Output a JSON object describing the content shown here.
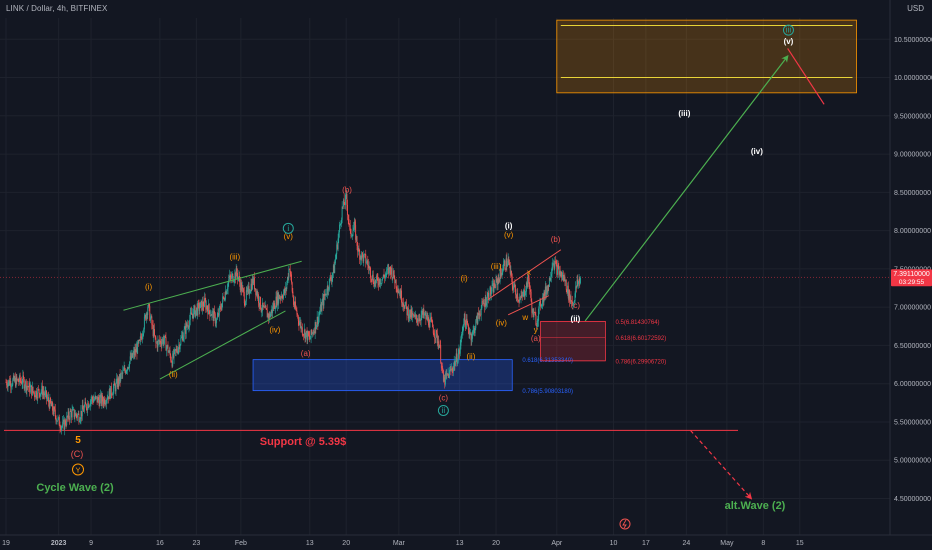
{
  "header": {
    "title": "LINK / Dollar, 4h, BITFINEX",
    "currency": "USD"
  },
  "price_tag": {
    "price": "7.39110000",
    "countdown": "03:29:55",
    "color": "#f23645"
  },
  "colors": {
    "background": "#131722",
    "up": "#26a69a",
    "down": "#ef5350",
    "support": "#f23645",
    "fib_zone_blue": "#2962ff",
    "fib_zone_red": "#f23645",
    "target_box": "#ff9800",
    "path_green": "#4caf50",
    "path_red": "#f23645"
  },
  "annotations": {
    "support": "Support @ 5.39$",
    "cycle_wave": "Cycle Wave (2)",
    "alt_wave": "alt.Wave (2)",
    "wave_5": "5",
    "wave_C": "(C)",
    "wave_Y": "Y"
  },
  "wave_labels": [
    {
      "text": "(i)",
      "color": "#ff9800",
      "t": 35.2,
      "p": 7.23
    },
    {
      "text": "(ii)",
      "color": "#ff9800",
      "t": 41.3,
      "p": 6.09
    },
    {
      "text": "(iii)",
      "color": "#ff9800",
      "t": 56.5,
      "p": 7.62
    },
    {
      "text": "(iv)",
      "color": "#ff9800",
      "t": 66.4,
      "p": 6.67
    },
    {
      "text": "(v)",
      "color": "#ff9800",
      "t": 69.7,
      "p": 7.89
    },
    {
      "text": "(a)",
      "color": "#ef5350",
      "t": 74.0,
      "p": 6.36
    },
    {
      "text": "(b)",
      "color": "#ef5350",
      "t": 84.2,
      "p": 8.5
    },
    {
      "text": "(c)",
      "color": "#ef5350",
      "t": 108.0,
      "p": 5.78
    },
    {
      "text": "(i)",
      "color": "#ff9800",
      "t": 113.1,
      "p": 7.34
    },
    {
      "text": "(ii)",
      "color": "#ff9800",
      "t": 114.8,
      "p": 6.32
    },
    {
      "text": "(iii)",
      "color": "#ff9800",
      "t": 121.0,
      "p": 7.5
    },
    {
      "text": "(iv)",
      "color": "#ff9800",
      "t": 122.3,
      "p": 6.76
    },
    {
      "text": "(v)",
      "color": "#ff9800",
      "t": 124.1,
      "p": 7.91
    },
    {
      "text": "(i)",
      "color": "#ffffff",
      "t": 124.1,
      "p": 8.03
    },
    {
      "text": "(b)",
      "color": "#ef5350",
      "t": 135.7,
      "p": 7.85
    },
    {
      "text": "x",
      "color": "#ff9800",
      "t": 129.1,
      "p": 7.42
    },
    {
      "text": "w",
      "color": "#ff9800",
      "t": 128.2,
      "p": 6.83
    },
    {
      "text": "y",
      "color": "#ff9800",
      "t": 130.8,
      "p": 6.67
    },
    {
      "text": "(a)",
      "color": "#ef5350",
      "t": 130.8,
      "p": 6.56
    },
    {
      "text": "(c)",
      "color": "#ef5350",
      "t": 140.6,
      "p": 6.99
    },
    {
      "text": "(ii)",
      "color": "#ffffff",
      "t": 140.6,
      "p": 6.81
    },
    {
      "text": "(iii)",
      "color": "#ffffff",
      "t": 167.5,
      "p": 9.5
    },
    {
      "text": "(iv)",
      "color": "#ffffff",
      "t": 185.4,
      "p": 9.0
    },
    {
      "text": "(v)",
      "color": "#ffffff",
      "t": 193.2,
      "p": 10.44
    }
  ],
  "circle_labels": [
    {
      "text": "i",
      "color": "#26a69a",
      "t": 69.7,
      "p": 8.03
    },
    {
      "text": "ii",
      "color": "#26a69a",
      "t": 108.0,
      "p": 5.65
    },
    {
      "text": "iii",
      "color": "#26a69a",
      "t": 193.2,
      "p": 10.62
    }
  ],
  "chart_data": {
    "type": "candlestick",
    "symbol": "LINK / Dollar",
    "interval": "4h",
    "exchange": "BITFINEX",
    "y_axis": {
      "ticks": [
        {
          "v": 10.5,
          "label": "10.50000000"
        },
        {
          "v": 10.0,
          "label": "10.00000000"
        },
        {
          "v": 9.5,
          "label": "9.50000000"
        },
        {
          "v": 9.0,
          "label": "9.00000000"
        },
        {
          "v": 8.5,
          "label": "8.50000000"
        },
        {
          "v": 8.0,
          "label": "8.00000000"
        },
        {
          "v": 7.5,
          "label": "7.50000000"
        },
        {
          "v": 7.0,
          "label": "7.00000000"
        },
        {
          "v": 6.5,
          "label": "6.50000000"
        },
        {
          "v": 6.0,
          "label": "6.00000000"
        },
        {
          "v": 5.5,
          "label": "5.50000000"
        },
        {
          "v": 5.0,
          "label": "5.00000000"
        },
        {
          "v": 4.5,
          "label": "4.50000000"
        }
      ],
      "range": [
        4.0,
        11.2
      ]
    },
    "x_axis": {
      "range_days": [
        -1,
        211
      ],
      "ticks": [
        {
          "t": 0,
          "label": "19"
        },
        {
          "t": 13,
          "label": "2023",
          "bold": true
        },
        {
          "t": 21,
          "label": "9"
        },
        {
          "t": 38,
          "label": "16"
        },
        {
          "t": 47,
          "label": "23"
        },
        {
          "t": 58,
          "label": "Feb"
        },
        {
          "t": 75,
          "label": "13"
        },
        {
          "t": 84,
          "label": "20"
        },
        {
          "t": 97,
          "label": "Mar"
        },
        {
          "t": 112,
          "label": "13"
        },
        {
          "t": 121,
          "label": "20"
        },
        {
          "t": 136,
          "label": "Apr"
        },
        {
          "t": 150,
          "label": "10"
        },
        {
          "t": 158,
          "label": "17"
        },
        {
          "t": 168,
          "label": "24"
        },
        {
          "t": 178,
          "label": "May"
        },
        {
          "t": 187,
          "label": "8"
        },
        {
          "t": 196,
          "label": "15"
        }
      ]
    },
    "price_path": [
      [
        0,
        6.02
      ],
      [
        4,
        6.04
      ],
      [
        7,
        5.88
      ],
      [
        9,
        5.91
      ],
      [
        11,
        5.72
      ],
      [
        13,
        5.5
      ],
      [
        14,
        5.44
      ],
      [
        16,
        5.62
      ],
      [
        18,
        5.58
      ],
      [
        21,
        5.8
      ],
      [
        24,
        5.78
      ],
      [
        27,
        5.96
      ],
      [
        30,
        6.24
      ],
      [
        33,
        6.52
      ],
      [
        35,
        7.02
      ],
      [
        37,
        6.52
      ],
      [
        39,
        6.58
      ],
      [
        41,
        6.3
      ],
      [
        43,
        6.55
      ],
      [
        46,
        6.92
      ],
      [
        49,
        7.05
      ],
      [
        52,
        6.82
      ],
      [
        55,
        7.35
      ],
      [
        57,
        7.45
      ],
      [
        59,
        7.1
      ],
      [
        61,
        7.35
      ],
      [
        63,
        7.0
      ],
      [
        65,
        6.88
      ],
      [
        67,
        7.12
      ],
      [
        69,
        7.2
      ],
      [
        70,
        7.55
      ],
      [
        71,
        7.05
      ],
      [
        73,
        6.72
      ],
      [
        75,
        6.58
      ],
      [
        77,
        6.85
      ],
      [
        79,
        7.2
      ],
      [
        81,
        7.5
      ],
      [
        82,
        7.9
      ],
      [
        83,
        8.28
      ],
      [
        84,
        8.42
      ],
      [
        85,
        7.95
      ],
      [
        86,
        8.05
      ],
      [
        87,
        7.72
      ],
      [
        89,
        7.6
      ],
      [
        91,
        7.32
      ],
      [
        93,
        7.38
      ],
      [
        95,
        7.5
      ],
      [
        97,
        7.22
      ],
      [
        99,
        6.95
      ],
      [
        101,
        6.84
      ],
      [
        103,
        6.9
      ],
      [
        105,
        6.78
      ],
      [
        107,
        6.52
      ],
      [
        108,
        6.02
      ],
      [
        110,
        6.18
      ],
      [
        112,
        6.42
      ],
      [
        113,
        6.85
      ],
      [
        115,
        6.62
      ],
      [
        117,
        6.95
      ],
      [
        119,
        7.15
      ],
      [
        121,
        7.3
      ],
      [
        123,
        7.55
      ],
      [
        124,
        7.6
      ],
      [
        125,
        7.3
      ],
      [
        127,
        7.08
      ],
      [
        128,
        7.2
      ],
      [
        129,
        7.38
      ],
      [
        130,
        6.92
      ],
      [
        131,
        6.82
      ],
      [
        132,
        7.05
      ],
      [
        134,
        7.3
      ],
      [
        135,
        7.62
      ],
      [
        136,
        7.5
      ],
      [
        138,
        7.35
      ],
      [
        139,
        7.15
      ],
      [
        140,
        7.05
      ],
      [
        141,
        7.3
      ],
      [
        142,
        7.39
      ]
    ],
    "seed": 7,
    "current_price": 7.3911,
    "support_level": 5.39,
    "zones": [
      {
        "name": "blue fib zone",
        "t1": 61,
        "t2": 125,
        "p1": 5.909,
        "p2": 6.314
      },
      {
        "name": "red fib zone",
        "t1": 132,
        "t2": 148,
        "p1": 6.299,
        "p2": 6.814
      },
      {
        "name": "target box",
        "t1": 136,
        "t2": 210,
        "p1": 9.8,
        "p2": 10.75
      }
    ],
    "fib_levels": [
      {
        "label": "0.618(6.31353340)",
        "p": 6.3135,
        "color": "#2962ff",
        "t": 127
      },
      {
        "label": "0.786(5.90803180)",
        "p": 5.908,
        "color": "#2962ff",
        "t": 127
      },
      {
        "label": "0.5(6.81430764)",
        "p": 6.8143,
        "color": "#f23645",
        "t": 150
      },
      {
        "label": "0.618(6.60172592)",
        "p": 6.6017,
        "color": "#f23645",
        "t": 150
      },
      {
        "label": "0.786(6.29906720)",
        "p": 6.2991,
        "color": "#f23645",
        "t": 150
      }
    ],
    "target_lines": [
      10.68,
      10.0
    ],
    "trend_lines": [
      {
        "color": "#4caf50",
        "t1": 29,
        "p1": 6.96,
        "t2": 73,
        "p2": 7.6
      },
      {
        "color": "#4caf50",
        "t1": 38,
        "p1": 6.06,
        "t2": 69,
        "p2": 6.95
      },
      {
        "color": "#ef5350",
        "t1": 119,
        "p1": 7.1,
        "t2": 137,
        "p2": 7.75
      },
      {
        "color": "#ef5350",
        "t1": 124,
        "p1": 6.9,
        "t2": 134,
        "p2": 7.15
      }
    ],
    "projection_green": {
      "t1": 143,
      "p1": 6.82,
      "t2": 193,
      "p2": 10.28
    },
    "projection_red_up": {
      "t1": 193,
      "p1": 10.38,
      "t2": 202,
      "p2": 9.65
    },
    "projection_red_dashed": {
      "t1": 169,
      "p1": 5.39,
      "t2": 184,
      "p2": 4.5
    }
  }
}
